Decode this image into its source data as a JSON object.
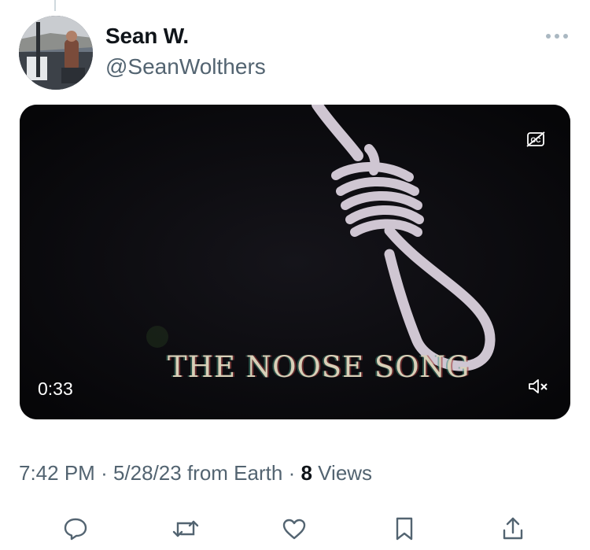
{
  "tweet": {
    "author": {
      "display_name": "Sean W.",
      "handle": "@SeanWolthers"
    },
    "media": {
      "type": "video",
      "title_text": "THE NOOSE SONG",
      "duration": "0:33",
      "captions_icon": "cc-off-icon",
      "mute_icon": "muted-speaker-icon"
    },
    "meta": {
      "time": "7:42 PM",
      "separator": "·",
      "date": "5/28/23",
      "source": "from Earth",
      "views_count": "8",
      "views_label": "Views"
    },
    "actions": [
      {
        "name": "reply",
        "icon": "reply-icon"
      },
      {
        "name": "retweet",
        "icon": "retweet-icon"
      },
      {
        "name": "like",
        "icon": "heart-icon"
      },
      {
        "name": "bookmark",
        "icon": "bookmark-icon"
      },
      {
        "name": "share",
        "icon": "share-icon"
      }
    ],
    "colors": {
      "text_primary": "#0f1419",
      "text_secondary": "#536471",
      "video_bg": "#0b0b0f"
    }
  }
}
